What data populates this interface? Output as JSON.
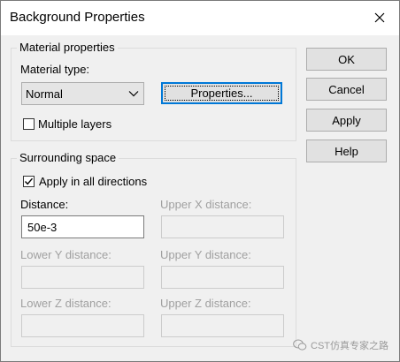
{
  "window": {
    "title": "Background Properties"
  },
  "material_group": {
    "legend": "Material properties",
    "material_type_label": "Material type:",
    "material_type_value": "Normal",
    "properties_button": "Properties...",
    "multiple_layers_label": "Multiple layers",
    "multiple_layers_checked": false
  },
  "surrounding_group": {
    "legend": "Surrounding space",
    "apply_all_label": "Apply in all directions",
    "apply_all_checked": true,
    "distance_label": "Distance:",
    "distance_value": "50e-3",
    "upper_x_label": "Upper X distance:",
    "lower_y_label": "Lower Y distance:",
    "upper_y_label": "Upper Y distance:",
    "lower_z_label": "Lower Z distance:",
    "upper_z_label": "Upper Z distance:"
  },
  "buttons": {
    "ok": "OK",
    "cancel": "Cancel",
    "apply": "Apply",
    "help": "Help"
  },
  "watermark": {
    "text": "CST仿真专家之路"
  },
  "icons": {
    "close": "close-icon",
    "chevron": "chevron-down-icon",
    "check": "checkmark-icon",
    "watermark": "wechat-icon"
  },
  "colors": {
    "accent": "#0078d7",
    "dialog_bg": "#f0f0f0",
    "disabled_text": "#a0a0a0"
  }
}
